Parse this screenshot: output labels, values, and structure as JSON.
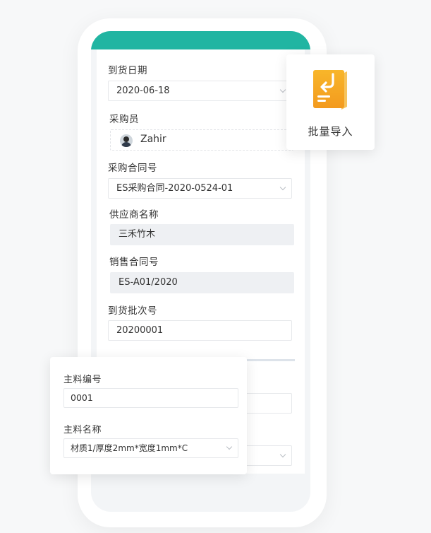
{
  "form": {
    "arrival_date_label": "到货日期",
    "arrival_date_value": "2020-06-18",
    "buyer_label": "采购员",
    "buyer_name": "Zahir",
    "purchase_contract_label": "采购合同号",
    "purchase_contract_value": "ES采购合同-2020-0524-01",
    "supplier_label": "供应商名称",
    "supplier_value": "三禾竹木",
    "sales_contract_label": "销售合同号",
    "sales_contract_value": "ES-A01/2020",
    "batch_label": "到货批次号",
    "batch_value": "20200001"
  },
  "material_popup": {
    "code_label": "主料编号",
    "code_value": "0001",
    "name_label": "主料名称",
    "name_value": "材质1/厚度2mm*宽度1mm*C"
  },
  "import_popup": {
    "label": "批量导入",
    "icon": "batch-import-icon",
    "icon_color": "#f5a623"
  },
  "colors": {
    "header": "#21b5a2",
    "accent_orange": "#f5a623"
  }
}
